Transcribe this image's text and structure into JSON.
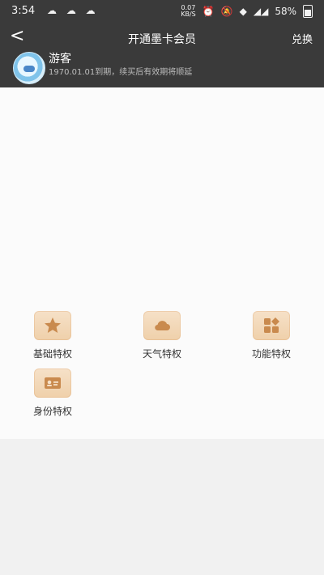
{
  "status_bar": {
    "time": "3:54",
    "notifications": "☁ ☁ ☁",
    "speed_top": "0.07",
    "speed_bottom": "KB/S",
    "battery": "58%"
  },
  "navbar": {
    "back_symbol": "<",
    "title": "开通墨卡会员",
    "redeem_label": "兑换"
  },
  "user": {
    "name": "游客",
    "subtitle": "1970.01.01到期，续买后有效期将顺延"
  },
  "privileges": [
    {
      "label": "基础特权",
      "icon": "star-icon"
    },
    {
      "label": "天气特权",
      "icon": "cloud-icon"
    },
    {
      "label": "功能特权",
      "icon": "apps-icon"
    },
    {
      "label": "身份特权",
      "icon": "id-card-icon"
    }
  ],
  "colors": {
    "header_bg": "#3a3a3a",
    "icon_tile_light": "#f6e1c8",
    "icon_tile_dark": "#efd0aa",
    "icon_glyph": "#c98a4e"
  }
}
